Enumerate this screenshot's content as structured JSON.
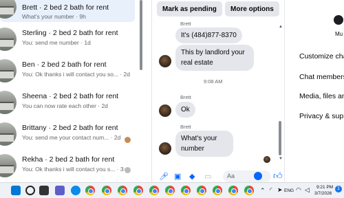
{
  "conversations": [
    {
      "title": "Brett · 2 bed 2 bath for rent",
      "subtitle": "What's your number · 9h",
      "active": true
    },
    {
      "title": "Sterling · 2 bed 2 bath for rent",
      "subtitle": "You: send me number · 1d"
    },
    {
      "title": "Ben · 2 bed 2 bath for rent",
      "subtitle": "You: Ok thanks i will contact you so... · 2d"
    },
    {
      "title": "Sheena · 2 bed 2 bath for rent",
      "subtitle": "You can now rate each other · 2d"
    },
    {
      "title": "Brittany · 2 bed 2 bath for rent",
      "subtitle": "You: send me your contact num... · 2d"
    },
    {
      "title": "Rekha · 2 bed 2 bath for rent",
      "subtitle": "You: Ok thanks i will contact you s... · 3d"
    }
  ],
  "chat": {
    "buttons": {
      "pending": "Mark as pending",
      "more": "More options"
    },
    "messages": [
      {
        "sender": "Brett",
        "text": "It's (484)877-8370"
      },
      {
        "text": "This by landlord your real estate"
      },
      {
        "timestamp": "9:08 AM"
      },
      {
        "sender": "Brett",
        "text": "Ok"
      },
      {
        "sender": "Brett",
        "text": "What's your number"
      }
    ],
    "composer_placeholder": "Aa"
  },
  "info": {
    "mute_label": "Mu",
    "rows": [
      "Customize cha",
      "Chat members",
      "Media, files an",
      "Privacy & supp"
    ]
  },
  "taskbar": {
    "time": "9:21 PM",
    "date": "3/7/2026",
    "lang": "ENG",
    "badge": "1"
  }
}
